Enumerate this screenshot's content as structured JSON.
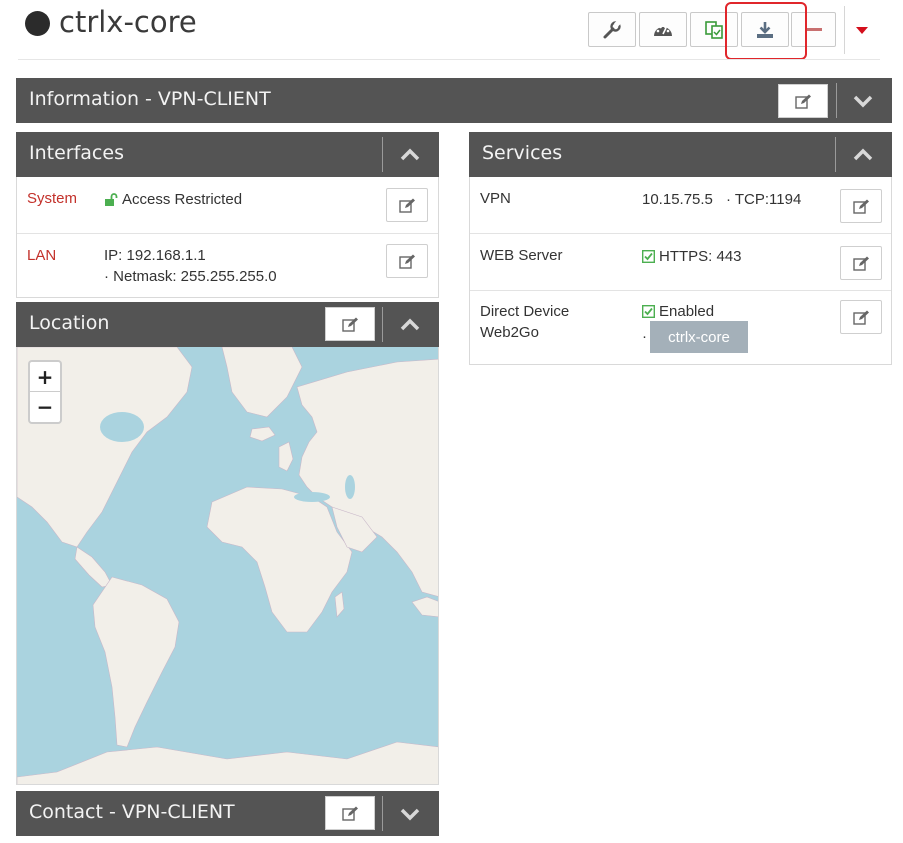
{
  "header": {
    "device_name": "ctrlx-core",
    "toolbar": [
      "wrench-icon",
      "dashboard-icon",
      "copy-icon",
      "download-icon",
      "minus-icon",
      "caret-down-icon"
    ]
  },
  "info_panel": {
    "title": "Information - VPN-CLIENT"
  },
  "interfaces": {
    "title": "Interfaces",
    "rows": [
      {
        "label": "System",
        "value": "Access Restricted"
      },
      {
        "label": "LAN",
        "line1": "IP: 192.168.1.1",
        "line2": "· Netmask: 255.255.255.0"
      }
    ]
  },
  "location": {
    "title": "Location",
    "zoom_in": "+",
    "zoom_out": "−"
  },
  "contact": {
    "title": "Contact - VPN-CLIENT"
  },
  "services": {
    "title": "Services",
    "rows": [
      {
        "label": "VPN",
        "value": "10.15.75.5",
        "extra": "· TCP:1194"
      },
      {
        "label": "WEB Server",
        "value": "HTTPS: 443"
      },
      {
        "label_line1": "Direct Device",
        "label_line2": "Web2Go",
        "value": "Enabled",
        "bullet": "·",
        "tag": "ctrlx-core"
      }
    ]
  },
  "colors": {
    "panel_head": "#545454",
    "label_red": "#c3312b",
    "check_green": "#4caf50",
    "highlight": "#e0262b",
    "map_water": "#aad3df",
    "map_land": "#f2efe9"
  }
}
